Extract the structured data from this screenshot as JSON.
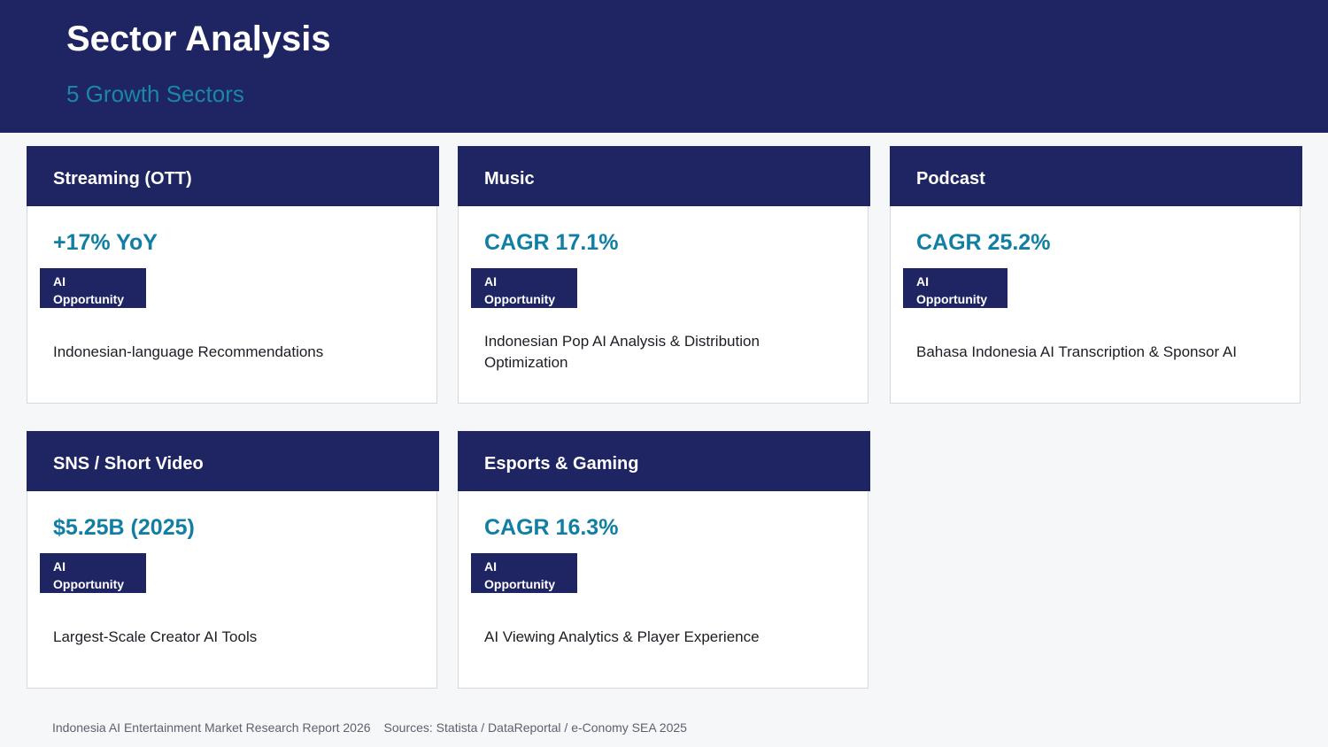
{
  "header": {
    "title": "Sector Analysis",
    "subtitle": "5 Growth Sectors"
  },
  "cards": [
    {
      "title": "Streaming (OTT)",
      "metric": "+17% YoY",
      "badge_line1": "AI",
      "badge_line2": "Opportunity",
      "description": "Indonesian-language Recommendations"
    },
    {
      "title": "Music",
      "metric": "CAGR 17.1%",
      "badge_line1": "AI",
      "badge_line2": "Opportunity",
      "description": "Indonesian Pop AI Analysis & Distribution Optimization"
    },
    {
      "title": "Podcast",
      "metric": "CAGR 25.2%",
      "badge_line1": "AI",
      "badge_line2": "Opportunity",
      "description": "Bahasa Indonesia AI Transcription & Sponsor AI"
    },
    {
      "title": "SNS / Short Video",
      "metric": "$5.25B (2025)",
      "badge_line1": "AI",
      "badge_line2": "Opportunity",
      "description": "Largest-Scale Creator AI Tools"
    },
    {
      "title": "Esports & Gaming",
      "metric": "CAGR 16.3%",
      "badge_line1": "AI",
      "badge_line2": "Opportunity",
      "description": "AI Viewing Analytics & Player Experience"
    }
  ],
  "footer": {
    "report": "Indonesia AI Entertainment Market Research Report 2026",
    "sources": "Sources: Statista / DataReportal / e-Conomy SEA 2025"
  },
  "colors": {
    "navy": "#1f2563",
    "accent_teal": "#117ea3",
    "background": "#f6f7f9"
  }
}
